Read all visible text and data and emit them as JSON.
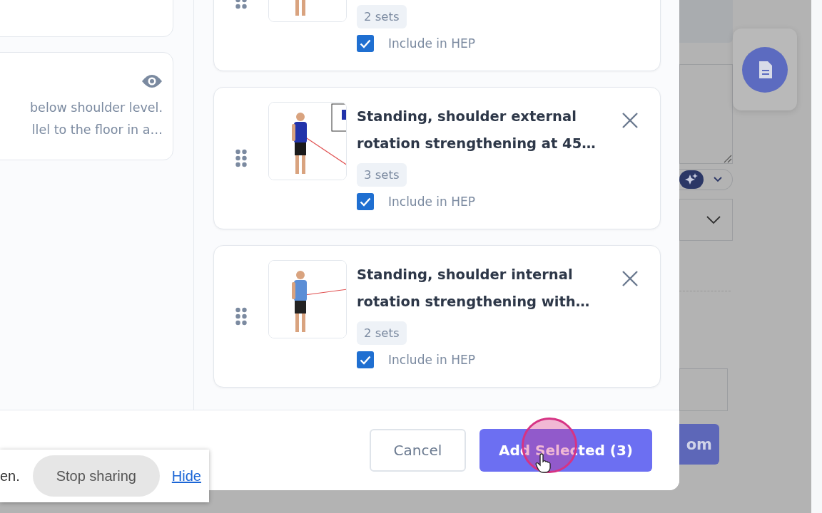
{
  "left_pane": {
    "description_lines": [
      "below shoulder level.",
      "llel to the floor in a…"
    ]
  },
  "exercises": [
    {
      "sets": "2 sets",
      "include_label": "Include in HEP",
      "checked": true,
      "thumbnail": {
        "kind": "picture"
      }
    },
    {
      "title_lines": [
        "Standing, shoulder external",
        "rotation strengthening at 45…"
      ],
      "sets": "3 sets",
      "include_label": "Include in HEP",
      "checked": true,
      "thumbnail": {
        "kind": "picture"
      }
    },
    {
      "title_lines": [
        "Standing, shoulder internal",
        "rotation strengthening with…"
      ],
      "sets": "2 sets",
      "include_label": "Include in HEP",
      "checked": true,
      "thumbnail": {
        "kind": "picture"
      }
    }
  ],
  "footer": {
    "buttons": [
      {
        "label": "Cancel",
        "kind": "secondary"
      },
      {
        "label": "Add Selected (3)",
        "kind": "primary"
      }
    ]
  },
  "backdrop": {
    "button_label": "om"
  },
  "share_bar": {
    "text": "en.",
    "stop_button": "Stop sharing",
    "hide_link": "Hide"
  }
}
